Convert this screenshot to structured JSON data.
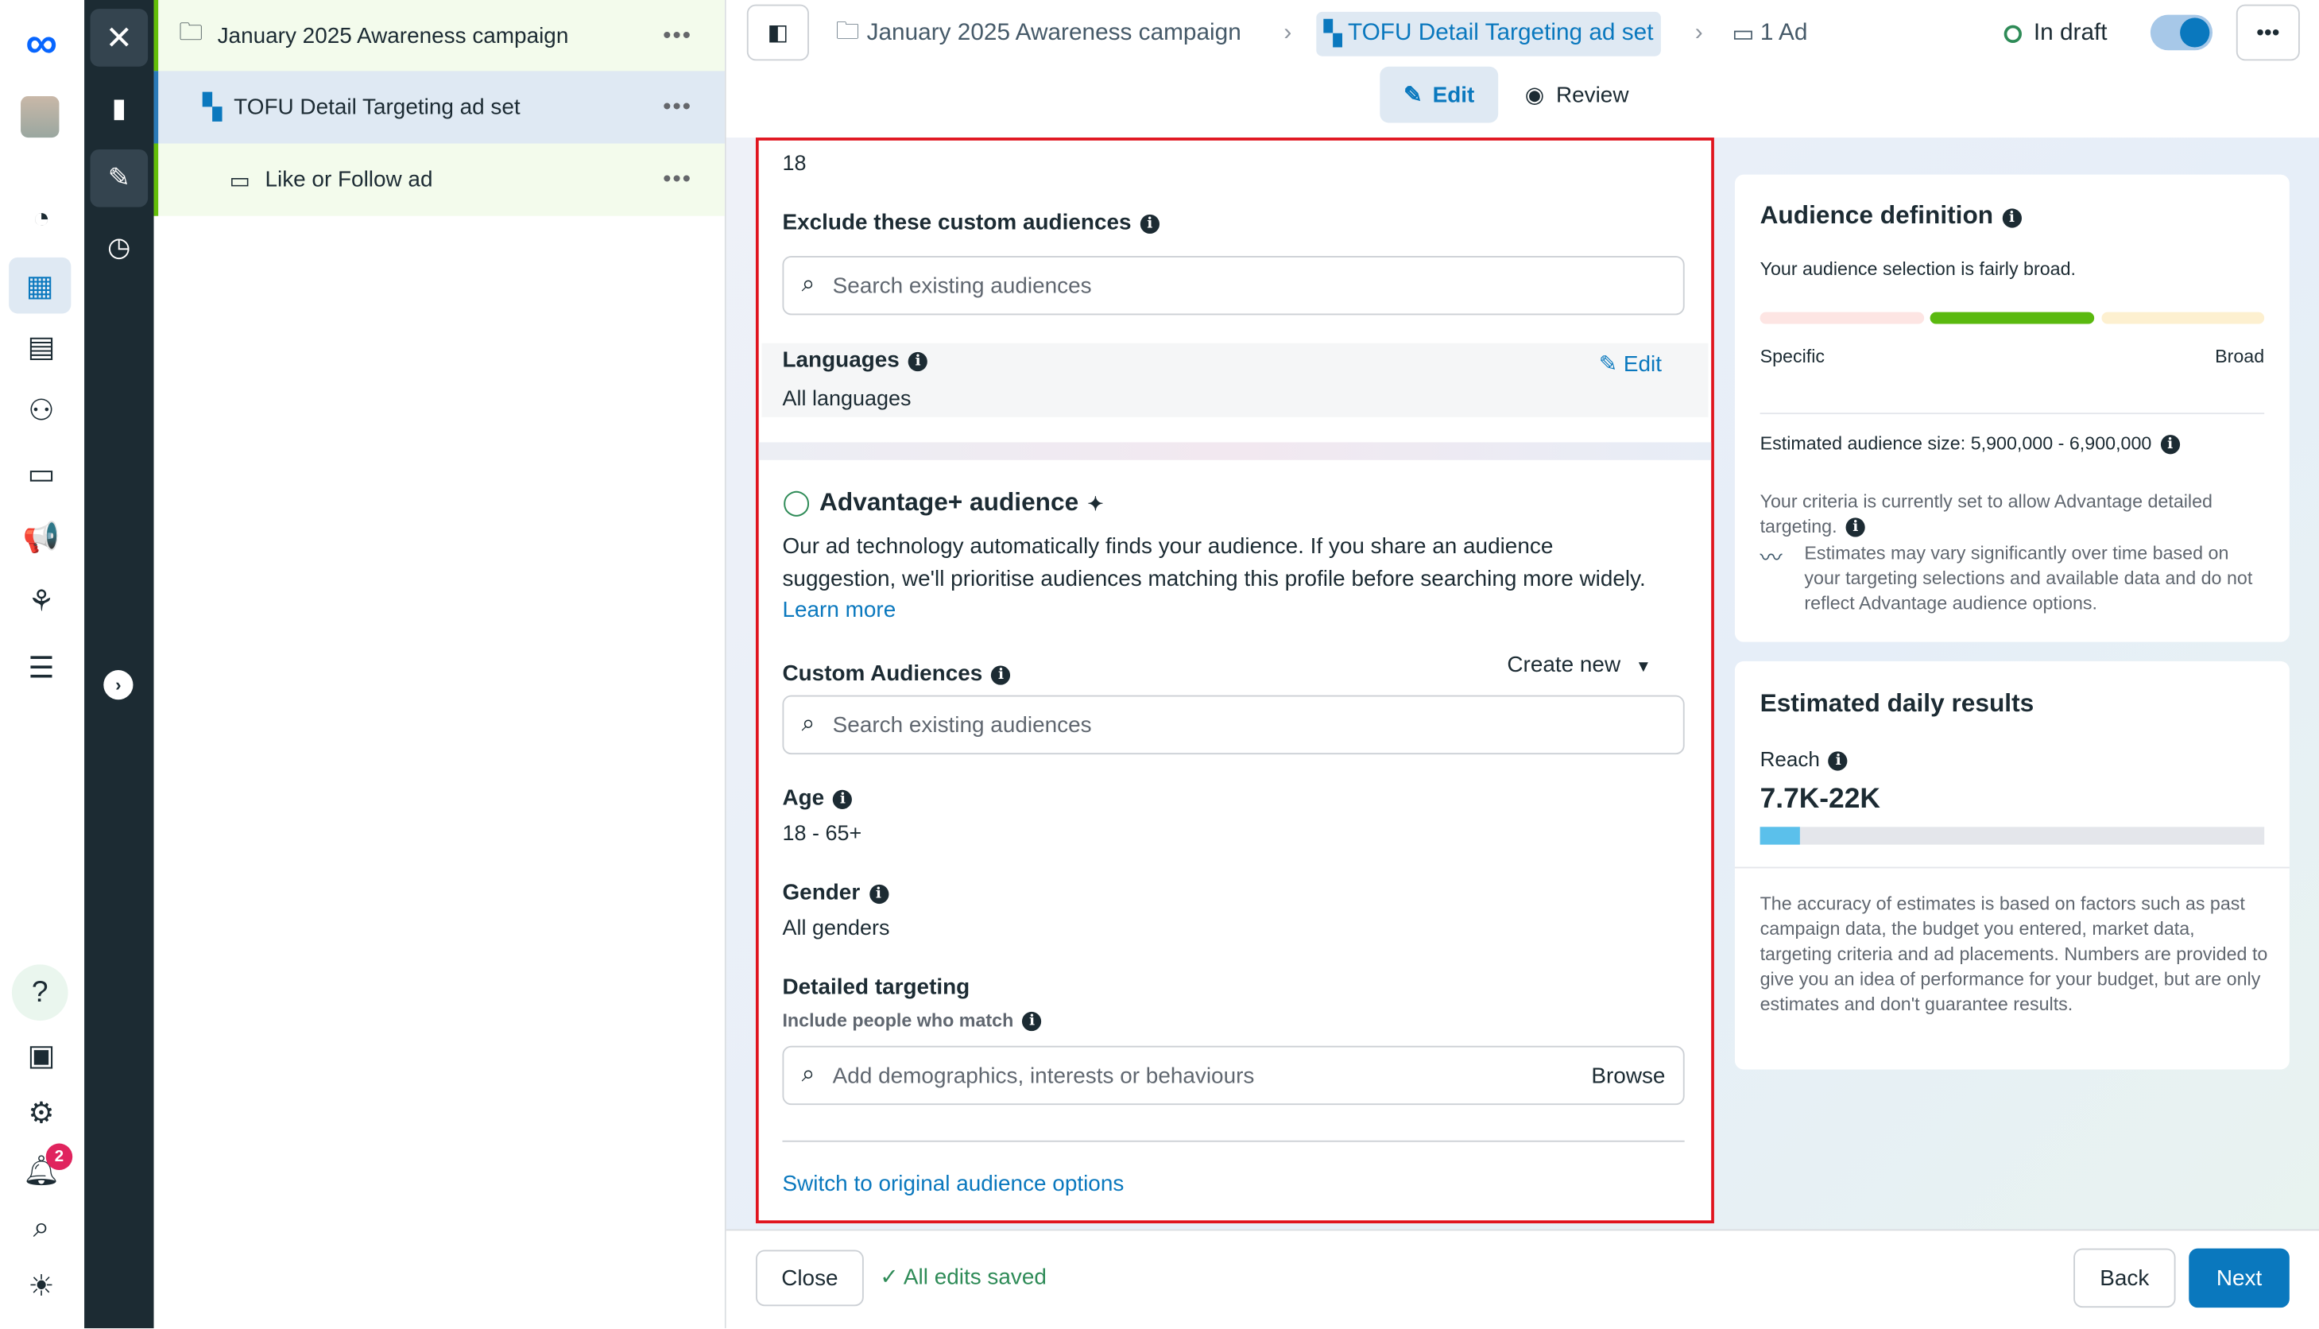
{
  "tree": {
    "campaign": "January 2025 Awareness campaign",
    "adset": "TOFU Detail Targeting ad set",
    "ad": "Like or Follow ad"
  },
  "header": {
    "campaign": "January 2025 Awareness campaign",
    "adset": "TOFU Detail Targeting ad set",
    "ad": "1 Ad",
    "status": "In draft",
    "edit_tab": "Edit",
    "review_tab": "Review"
  },
  "form": {
    "age_min_value": "18",
    "exclude_label": "Exclude these custom audiences",
    "exclude_placeholder": "Search existing audiences",
    "languages_label": "Languages",
    "languages_edit": "Edit",
    "languages_value": "All languages",
    "advantage_title": "Advantage+ audience",
    "advantage_desc": "Our ad technology automatically finds your audience. If you share an audience suggestion, we'll prioritise audiences matching this profile before searching more widely.",
    "learn_more": "Learn more",
    "custom_label": "Custom Audiences",
    "create_new": "Create new",
    "custom_placeholder": "Search existing audiences",
    "age_label": "Age",
    "age_value": "18 - 65+",
    "gender_label": "Gender",
    "gender_value": "All genders",
    "detailed_label": "Detailed targeting",
    "detailed_sub": "Include people who match",
    "detailed_placeholder": "Add demographics, interests or behaviours",
    "browse": "Browse",
    "switch_link": "Switch to original audience options"
  },
  "audience": {
    "title": "Audience definition",
    "summary": "Your audience selection is fairly broad.",
    "specific": "Specific",
    "broad": "Broad",
    "size_label": "Estimated audience size:",
    "size_value": "5,900,000 - 6,900,000",
    "criteria": "Your criteria is currently set to allow Advantage detailed targeting.",
    "estimates_note": "Estimates may vary significantly over time based on your targeting selections and available data and do not reflect Advantage audience options.",
    "level": "middle",
    "colors": {
      "specific": "#fde5e3",
      "active": "#5ab90f",
      "broad": "#fdf0d0"
    }
  },
  "daily": {
    "title": "Estimated daily results",
    "reach_label": "Reach",
    "reach_value": "7.7K-22K",
    "reach_fill_pct": 8,
    "disclaimer": "The accuracy of estimates is based on factors such as past campaign data, the budget you entered, market data, targeting criteria and ad placements. Numbers are provided to give you an idea of performance for your budget, but are only estimates and don't guarantee results."
  },
  "footer": {
    "close": "Close",
    "saved": "All edits saved",
    "back": "Back",
    "next": "Next"
  },
  "notifications_count": "2",
  "accent": "#0a78be"
}
